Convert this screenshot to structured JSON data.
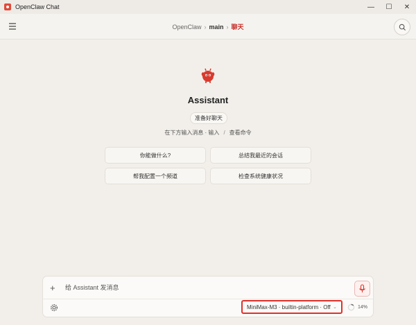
{
  "window": {
    "title": "OpenClaw Chat",
    "controls": [
      "—",
      "☐",
      "✕"
    ]
  },
  "breadcrumb": {
    "root": "OpenClaw",
    "branch": "main",
    "current": "聊天"
  },
  "assistant": {
    "name": "Assistant",
    "status": "准备好聊天"
  },
  "hint": {
    "left": "在下方输入消息 · 输入",
    "right": "查看命令",
    "separator": "/"
  },
  "suggestions": [
    "你能做什么?",
    "总结我最近的会话",
    "帮我配置一个频道",
    "检查系统健康状况"
  ],
  "composer": {
    "placeholder": "给 Assistant 发消息",
    "model": "MiniMax-M3 · builtin-platform · Off",
    "context_usage": "14%",
    "context_fraction": 0.14
  },
  "colors": {
    "accent": "#e0302a",
    "avatar": "#d93a2e",
    "background": "#f2efea"
  }
}
